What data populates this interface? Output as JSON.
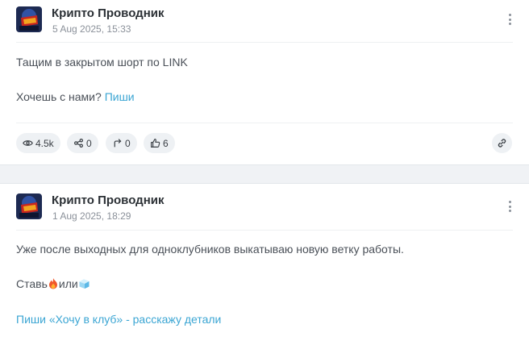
{
  "posts": [
    {
      "author": "Крипто Проводник",
      "date": "5 Aug 2025, 15:33",
      "line1": "Тащим в закрытом шорт по LINK",
      "line2_prefix": "Хочешь с нами? ",
      "line2_link": "Пиши",
      "stats": {
        "views": "4.5k",
        "shares": "0",
        "reposts": "0",
        "likes": "6"
      }
    },
    {
      "author": "Крипто Проводник",
      "date": "1 Aug 2025, 18:29",
      "line1": "Уже после выходных для одноклубников выкатываю новую ветку работы.",
      "line2_prefix": "Ставь",
      "line2_mid": "или",
      "line3_link": "Пиши «Хочу в клуб» - расскажу детали"
    }
  ],
  "colors": {
    "accent": "#3aa5d3",
    "pill_bg": "#eef1f4",
    "separator": "#f0f2f5"
  },
  "icons": [
    "avatar",
    "more-vertical-icon",
    "eye-icon",
    "share-icon",
    "repost-icon",
    "thumbs-up-icon",
    "link-icon",
    "fire-emoji",
    "ice-emoji"
  ]
}
